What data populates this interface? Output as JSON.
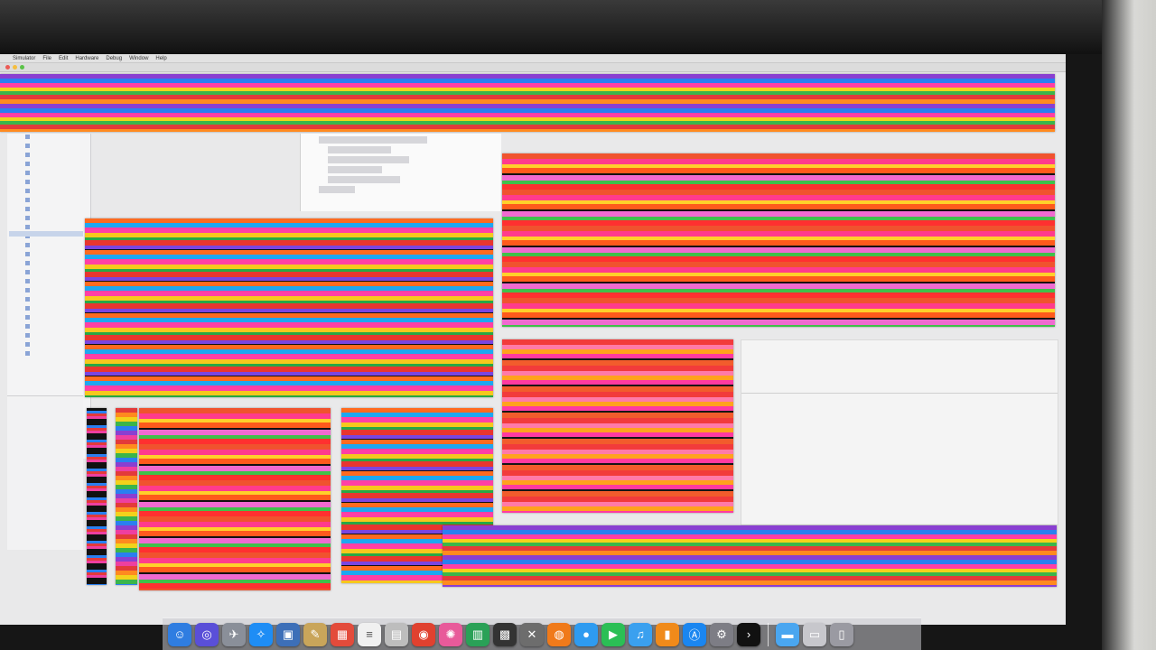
{
  "menubar": {
    "apple": "",
    "items": [
      "Simulator",
      "File",
      "Edit",
      "Hardware",
      "Debug",
      "Window",
      "Help"
    ]
  },
  "window": {
    "title": ""
  },
  "dock": {
    "icons": [
      {
        "name": "finder-icon",
        "glyph": "☺",
        "color": "#2f7de1"
      },
      {
        "name": "siri-icon",
        "glyph": "◎",
        "color": "#5a4fd8"
      },
      {
        "name": "launchpad-icon",
        "glyph": "✈",
        "color": "#8a8f99"
      },
      {
        "name": "safari-icon",
        "glyph": "✧",
        "color": "#1e8df5"
      },
      {
        "name": "preview-icon",
        "glyph": "▣",
        "color": "#3d6fb8"
      },
      {
        "name": "notes-icon",
        "glyph": "✎",
        "color": "#c9a55a"
      },
      {
        "name": "calendar-icon",
        "glyph": "▦",
        "color": "#e34b3b"
      },
      {
        "name": "textedit-icon",
        "glyph": "≡",
        "color": "#f0f0f0"
      },
      {
        "name": "document-icon",
        "glyph": "▤",
        "color": "#bdbdbd"
      },
      {
        "name": "chrome-icon",
        "glyph": "◉",
        "color": "#e0412f"
      },
      {
        "name": "color-picker-icon",
        "glyph": "✺",
        "color": "#e85a9a"
      },
      {
        "name": "activity-monitor-icon",
        "glyph": "▥",
        "color": "#2aa157"
      },
      {
        "name": "photo-booth-icon",
        "glyph": "▩",
        "color": "#333333"
      },
      {
        "name": "xcode-instruments-icon",
        "glyph": "✕",
        "color": "#6d6d6d"
      },
      {
        "name": "firefox-icon",
        "glyph": "◍",
        "color": "#f07a1a"
      },
      {
        "name": "messages-icon",
        "glyph": "●",
        "color": "#2e9bf0"
      },
      {
        "name": "facetime-icon",
        "glyph": "▶",
        "color": "#2bbf55"
      },
      {
        "name": "itunes-icon",
        "glyph": "♫",
        "color": "#3aa0ef"
      },
      {
        "name": "ibooks-icon",
        "glyph": "▮",
        "color": "#f08a1a"
      },
      {
        "name": "app-store-icon",
        "glyph": "Ⓐ",
        "color": "#1a86f0"
      },
      {
        "name": "system-preferences-icon",
        "glyph": "⚙",
        "color": "#7d7d85"
      },
      {
        "name": "terminal-icon",
        "glyph": "›",
        "color": "#111111"
      },
      {
        "name": "downloads-folder-icon",
        "glyph": "▬",
        "color": "#4aa6f0"
      },
      {
        "name": "screenshots-folder-icon",
        "glyph": "▭",
        "color": "#c7c7cc"
      },
      {
        "name": "trash-icon",
        "glyph": "▯",
        "color": "#9a9aa2"
      }
    ]
  }
}
